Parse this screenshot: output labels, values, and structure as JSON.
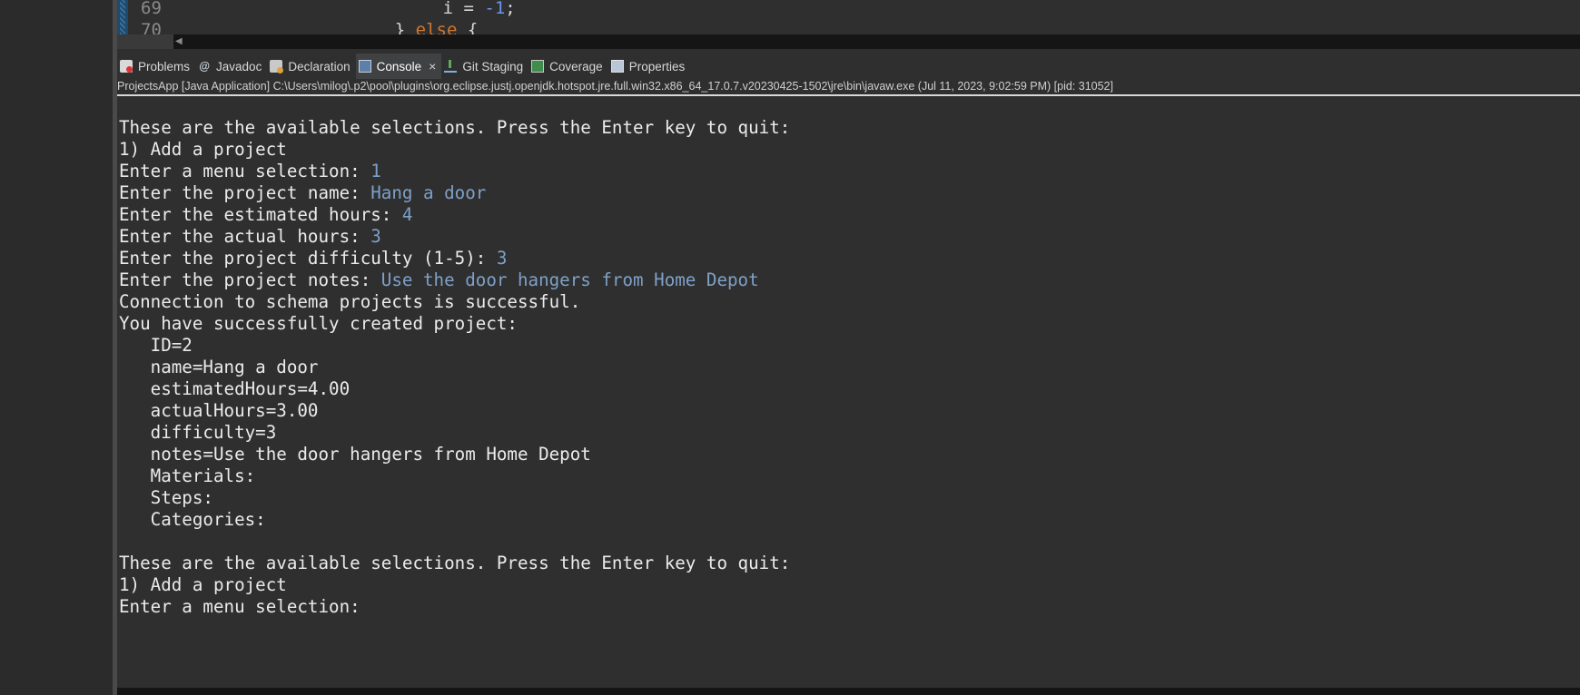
{
  "editor": {
    "lines": [
      {
        "number": "69",
        "code_pre": "      i = ",
        "code_num": "-1",
        "code_post": ";"
      },
      {
        "number": "70",
        "code_pre": "    } ",
        "code_kw": "else",
        "code_post": " {"
      }
    ]
  },
  "tabs": [
    {
      "label": "Problems",
      "icon": "problems-icon"
    },
    {
      "label": "Javadoc",
      "icon": "javadoc-icon",
      "glyph": "@"
    },
    {
      "label": "Declaration",
      "icon": "declaration-icon"
    },
    {
      "label": "Console",
      "icon": "console-icon",
      "active": true,
      "close": "×"
    },
    {
      "label": "Git Staging",
      "icon": "git-staging-icon"
    },
    {
      "label": "Coverage",
      "icon": "coverage-icon"
    },
    {
      "label": "Properties",
      "icon": "properties-icon"
    }
  ],
  "process_label": "ProjectsApp [Java Application] C:\\Users\\milog\\.p2\\pool\\plugins\\org.eclipse.justj.openjdk.hotspot.jre.full.win32.x86_64_17.0.7.v20230425-1502\\jre\\bin\\javaw.exe  (Jul 11, 2023, 9:02:59 PM) [pid: 31052]",
  "console": {
    "lines": [
      {
        "text": "These are the available selections. Press the Enter key to quit:"
      },
      {
        "text": "1) Add a project"
      },
      {
        "text": "Enter a menu selection: ",
        "input": "1"
      },
      {
        "text": "Enter the project name: ",
        "input": "Hang a door"
      },
      {
        "text": "Enter the estimated hours: ",
        "input": "4"
      },
      {
        "text": "Enter the actual hours: ",
        "input": "3"
      },
      {
        "text": "Enter the project difficulty (1-5): ",
        "input": "3"
      },
      {
        "text": "Enter the project notes: ",
        "input": "Use the door hangers from Home Depot"
      },
      {
        "text": "Connection to schema projects is successful."
      },
      {
        "text": "You have successfully created project:"
      },
      {
        "text": "   ID=2"
      },
      {
        "text": "   name=Hang a door"
      },
      {
        "text": "   estimatedHours=4.00"
      },
      {
        "text": "   actualHours=3.00"
      },
      {
        "text": "   difficulty=3"
      },
      {
        "text": "   notes=Use the door hangers from Home Depot"
      },
      {
        "text": "   Materials:"
      },
      {
        "text": "   Steps:"
      },
      {
        "text": "   Categories:"
      },
      {
        "text": ""
      },
      {
        "text": "These are the available selections. Press the Enter key to quit:"
      },
      {
        "text": "1) Add a project"
      },
      {
        "text": "Enter a menu selection: "
      }
    ]
  }
}
